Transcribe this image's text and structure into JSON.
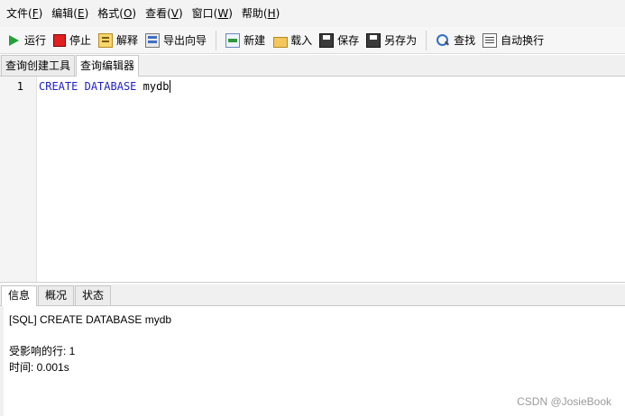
{
  "menu": [
    {
      "text": "文件(",
      "key": "F",
      "end": ")"
    },
    {
      "text": "编辑(",
      "key": "E",
      "end": ")"
    },
    {
      "text": "格式(",
      "key": "O",
      "end": ")"
    },
    {
      "text": "查看(",
      "key": "V",
      "end": ")"
    },
    {
      "text": "窗口(",
      "key": "W",
      "end": ")"
    },
    {
      "text": "帮助(",
      "key": "H",
      "end": ")"
    }
  ],
  "toolbar": {
    "run": "运行",
    "stop": "停止",
    "explain": "解释",
    "export_wizard": "导出向导",
    "new": "新建",
    "load": "载入",
    "save": "保存",
    "save_as": "另存为",
    "find": "查找",
    "word_wrap": "自动换行"
  },
  "editor_tabs": [
    "查询创建工具",
    "查询编辑器"
  ],
  "editor": {
    "line_number": "1",
    "keyword1": "CREATE",
    "keyword2": "DATABASE",
    "identifier": "mydb"
  },
  "bottom_tabs": [
    "信息",
    "概况",
    "状态"
  ],
  "output": {
    "sql_line": "[SQL] CREATE DATABASE mydb",
    "affected_rows": "受影响的行: 1",
    "time": "时间: 0.001s"
  },
  "watermark": "CSDN @JosieBook",
  "colors": {
    "keyword": "#1f1fc8",
    "run_icon": "#22a33a",
    "stop_icon": "#e02020"
  }
}
